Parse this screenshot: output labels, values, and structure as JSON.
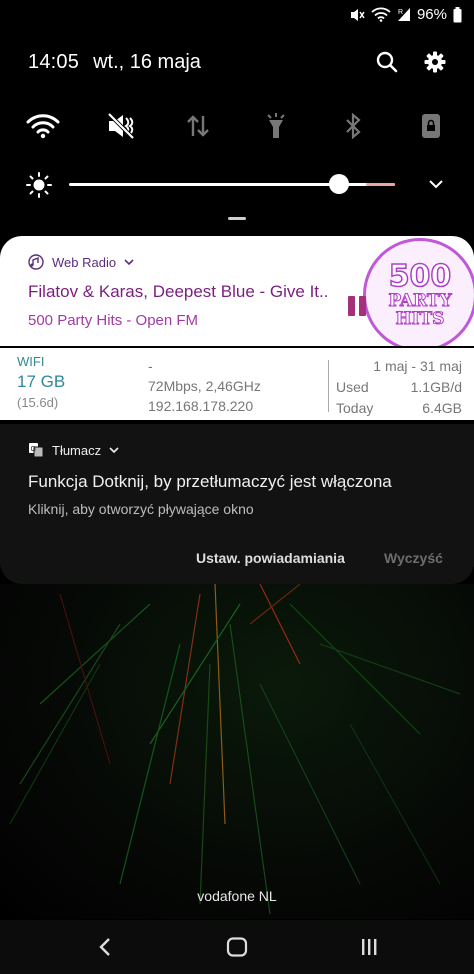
{
  "status": {
    "battery": "96%"
  },
  "header": {
    "time": "14:05",
    "date": "wt., 16 maja"
  },
  "toggles": [
    "wifi-icon",
    "mute-icon",
    "data-transfer-icon",
    "flashlight-icon",
    "bluetooth-icon",
    "lock-rotation-icon"
  ],
  "media": {
    "app_name": "Web Radio",
    "title": "Filatov & Karas, Deepest Blue - Give It..",
    "subtitle": "500 Party Hits - Open FM",
    "art_line1": "500",
    "art_line2": "PARTY",
    "art_line3": "HITS",
    "accent": "#7a1f7f"
  },
  "wifi": {
    "label": "WIFI",
    "usage": "17 GB",
    "days": "(15.6d)",
    "ssid": "-",
    "speed": "72Mbps, 2,46GHz",
    "ip": "192.168.178.220",
    "range": "1 maj - 31 maj",
    "used_label": "Used",
    "used_value": "1.1GB/d",
    "today_label": "Today",
    "today_value": "6.4GB",
    "accent": "#2e8a98"
  },
  "translator": {
    "app_name": "Tłumacz",
    "title": "Funkcja Dotknij, by przetłumaczyć jest włączona",
    "subtitle": "Kliknij, aby otworzyć pływające okno",
    "settings_label": "Ustaw. powiadamiania",
    "clear_label": "Wyczyść"
  },
  "carrier": "vodafone NL",
  "nav": [
    "back-icon",
    "home-icon",
    "recents-icon"
  ]
}
